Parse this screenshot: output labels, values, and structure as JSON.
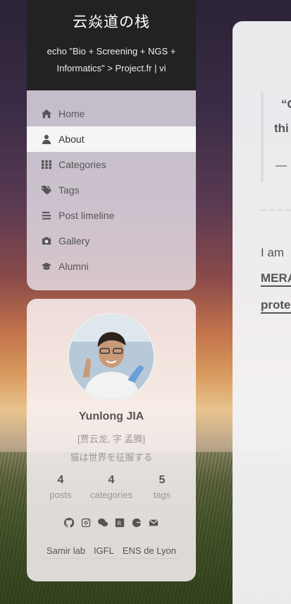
{
  "site": {
    "title": "云焱道の栈",
    "subtitle": "echo \"Bio + Screening + NGS + Informatics\" > Project.fr | vi"
  },
  "menu": {
    "items": [
      {
        "label": "Home",
        "icon": "home-icon"
      },
      {
        "label": "About",
        "icon": "user-icon",
        "active": true
      },
      {
        "label": "Categories",
        "icon": "grid-icon"
      },
      {
        "label": "Tags",
        "icon": "tags-icon"
      },
      {
        "label": "Post limeline",
        "icon": "list-icon"
      },
      {
        "label": "Gallery",
        "icon": "camera-icon"
      },
      {
        "label": "Alumni",
        "icon": "graduation-cap-icon"
      }
    ]
  },
  "profile": {
    "name": "Yunlong JIA",
    "alias": "[贾云龙, 字 孟腾]",
    "motto": "猫は世界を征服する",
    "stats": [
      {
        "num": "4",
        "label": "posts"
      },
      {
        "num": "4",
        "label": "categories"
      },
      {
        "num": "5",
        "label": "tags"
      }
    ],
    "socials": [
      "github-icon",
      "instagram-icon",
      "wechat-icon",
      "researchgate-icon",
      "google-icon",
      "email-icon"
    ],
    "links": [
      "Samir lab",
      "IGFL",
      "ENS de Lyon"
    ]
  },
  "content": {
    "quote_line1": "“C",
    "quote_line2": "thi",
    "quote_line3": "—",
    "intro": "I am",
    "bold1": "MERA",
    "bold2": "prote"
  },
  "colors": {
    "header_bg": "#222222",
    "active_item_bg": "#f5f5f5",
    "text": "#555555",
    "muted": "#999999"
  }
}
